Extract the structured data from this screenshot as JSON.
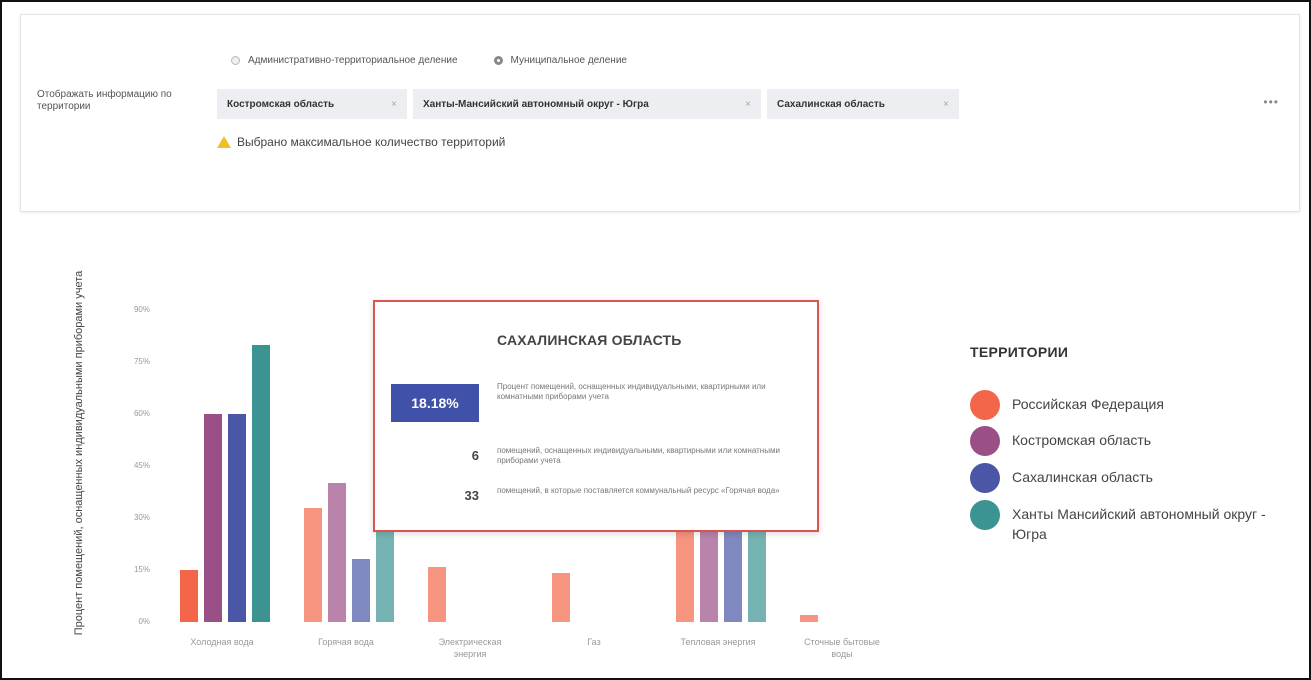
{
  "filter": {
    "radio_options": [
      {
        "label": "Административно-территориальное деление",
        "selected": false
      },
      {
        "label": "Муниципальное деление",
        "selected": true
      }
    ],
    "label": "Отображать информацию по территории",
    "tags": [
      "Костромская область",
      "Ханты-Мансийский автономный округ - Югра",
      "Сахалинская область"
    ],
    "tag_remove_symbol": "×",
    "more": "•••",
    "warning": "Выбрано максимальное количество территорий"
  },
  "chart_data": {
    "type": "bar",
    "ylabel": "Процент помещений, оснащенных индивидуальными приборами учета",
    "y_ticks": [
      "0%",
      "15%",
      "30%",
      "45%",
      "60%",
      "75%",
      "90%"
    ],
    "ylim": [
      0,
      90
    ],
    "categories": [
      "Холодная вода",
      "Горячая вода",
      "Электрическая энергия",
      "Газ",
      "Тепловая энергия",
      "Сточные бытовые воды"
    ],
    "series": [
      {
        "name": "Российская Федерация",
        "color": "#f4664a",
        "values": [
          15,
          33,
          16,
          14,
          36,
          2
        ]
      },
      {
        "name": "Костромская область",
        "color": "#9b4f87",
        "values": [
          60,
          40,
          null,
          null,
          36,
          null
        ]
      },
      {
        "name": "Сахалинская область",
        "color": "#4a56a6",
        "values": [
          60,
          18.18,
          null,
          null,
          30,
          null
        ]
      },
      {
        "name": "Ханты Мансийский автономный округ - Югра",
        "color": "#3b9392",
        "values": [
          80,
          36,
          null,
          null,
          36,
          null
        ]
      }
    ],
    "grid": false,
    "legend_position": "right"
  },
  "tooltip": {
    "title": "САХАЛИНСКАЯ ОБЛАСТЬ",
    "percent": "18.18%",
    "percent_desc": "Процент помещений, оснащенных индивидуальными, квартирными или комнатными приборами учета",
    "rows": [
      {
        "value": "6",
        "desc": "помещений, оснащенных индивидуальными, квартирными или комнатными приборами учета"
      },
      {
        "value": "33",
        "desc": "помещений, в которые поставляется коммунальный ресурс «Горячая вода»"
      }
    ]
  },
  "legend": {
    "title": "ТЕРРИТОРИИ",
    "items": [
      {
        "label": "Российская Федерация",
        "color": "#f4664a"
      },
      {
        "label": "Костромская область",
        "color": "#9b4f87"
      },
      {
        "label": "Сахалинская область",
        "color": "#4a56a6"
      },
      {
        "label": "Ханты Мансийский автономный округ - Югра",
        "color": "#3b9392"
      }
    ]
  }
}
